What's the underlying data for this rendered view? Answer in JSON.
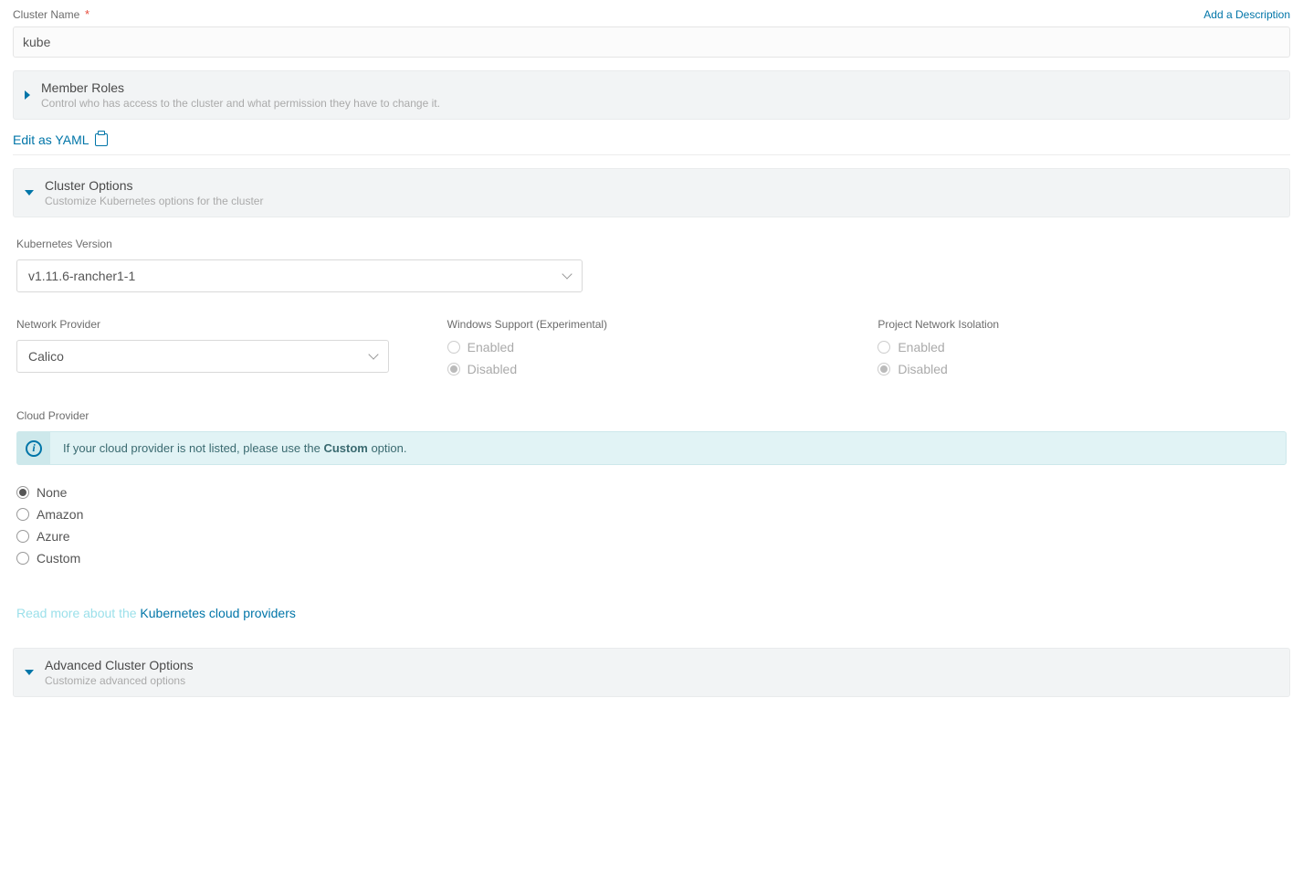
{
  "top": {
    "cluster_name_label": "Cluster Name",
    "required_mark": "*",
    "add_description": "Add a Description",
    "cluster_name_value": "kube"
  },
  "member_roles": {
    "title": "Member Roles",
    "subtitle": "Control who has access to the cluster and what permission they have to change it."
  },
  "yaml": {
    "label": "Edit as YAML"
  },
  "cluster_options": {
    "title": "Cluster Options",
    "subtitle": "Customize Kubernetes options for the cluster",
    "k8s_version_label": "Kubernetes Version",
    "k8s_version_value": "v1.11.6-rancher1-1",
    "network_provider_label": "Network Provider",
    "network_provider_value": "Calico",
    "windows_support_label": "Windows Support (Experimental)",
    "windows_enabled": "Enabled",
    "windows_disabled": "Disabled",
    "pni_label": "Project Network Isolation",
    "pni_enabled": "Enabled",
    "pni_disabled": "Disabled",
    "cloud_provider_label": "Cloud Provider",
    "info_prefix": "If your cloud provider is not listed, please use the ",
    "info_bold": "Custom",
    "info_suffix": " option.",
    "cloud_none": "None",
    "cloud_amazon": "Amazon",
    "cloud_azure": "Azure",
    "cloud_custom": "Custom",
    "read_more_prefix": "Read more about the ",
    "read_more_link": "Kubernetes cloud providers"
  },
  "advanced": {
    "title": "Advanced Cluster Options",
    "subtitle": "Customize advanced options"
  }
}
